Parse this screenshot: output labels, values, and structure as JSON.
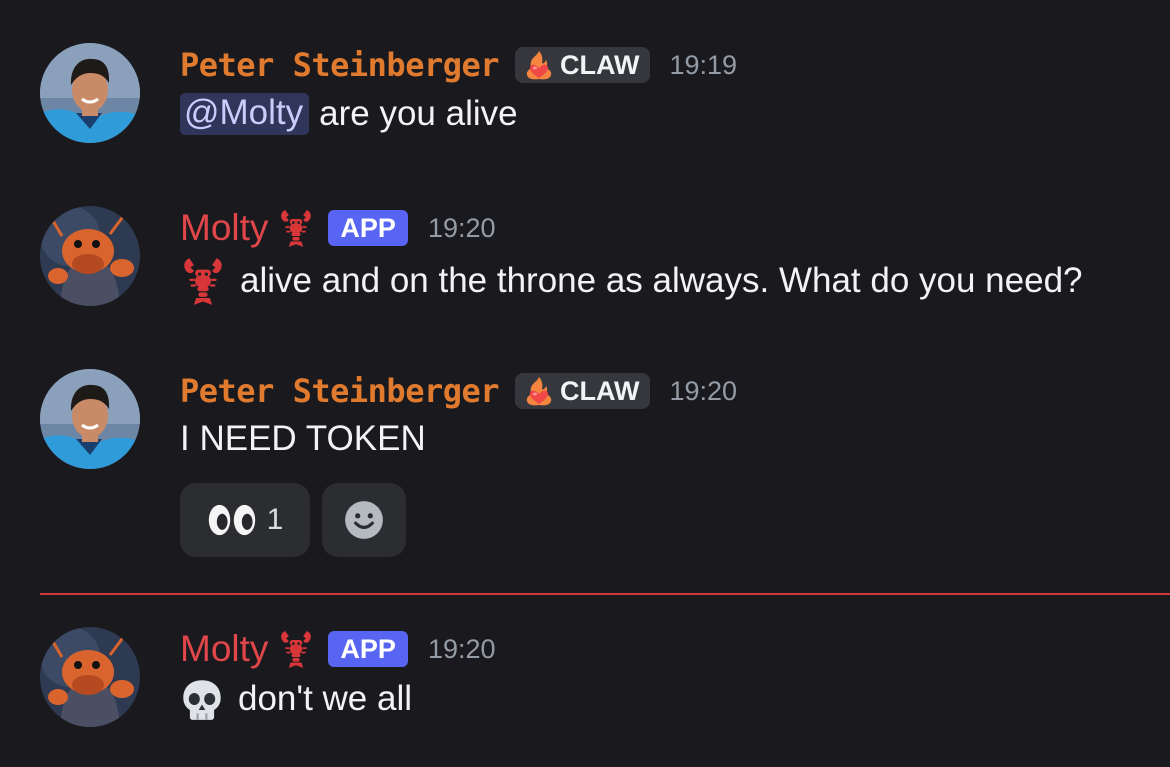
{
  "messages": [
    {
      "author": "Peter Steinberger",
      "tag_label": "CLAW",
      "time": "19:19",
      "mention": "@Molty",
      "text": "are you alive"
    },
    {
      "author": "Molty",
      "badge": "APP",
      "time": "19:20",
      "text": "alive and on the throne as always. What do you need?"
    },
    {
      "author": "Peter Steinberger",
      "tag_label": "CLAW",
      "time": "19:20",
      "text": "I NEED TOKEN",
      "reactions": [
        {
          "emoji": "eyes-emoji",
          "count": "1"
        },
        {
          "emoji": "add-reaction-icon"
        }
      ]
    },
    {
      "author": "Molty",
      "badge": "APP",
      "time": "19:20",
      "text": "don't we all"
    }
  ],
  "colors": {
    "background": "#1a1a1e",
    "human_name": "#e07a2e",
    "bot_name": "#e0464a",
    "app_badge": "#5865f2",
    "new_divider": "#d0363a",
    "mention_bg": "#30355a"
  },
  "icons": {
    "tag_icon": "fire-heart-icon",
    "bot_name_icon": "lobster-icon",
    "bot_emoji_1": "lobster-emoji",
    "bot_emoji_2": "skull-emoji"
  }
}
